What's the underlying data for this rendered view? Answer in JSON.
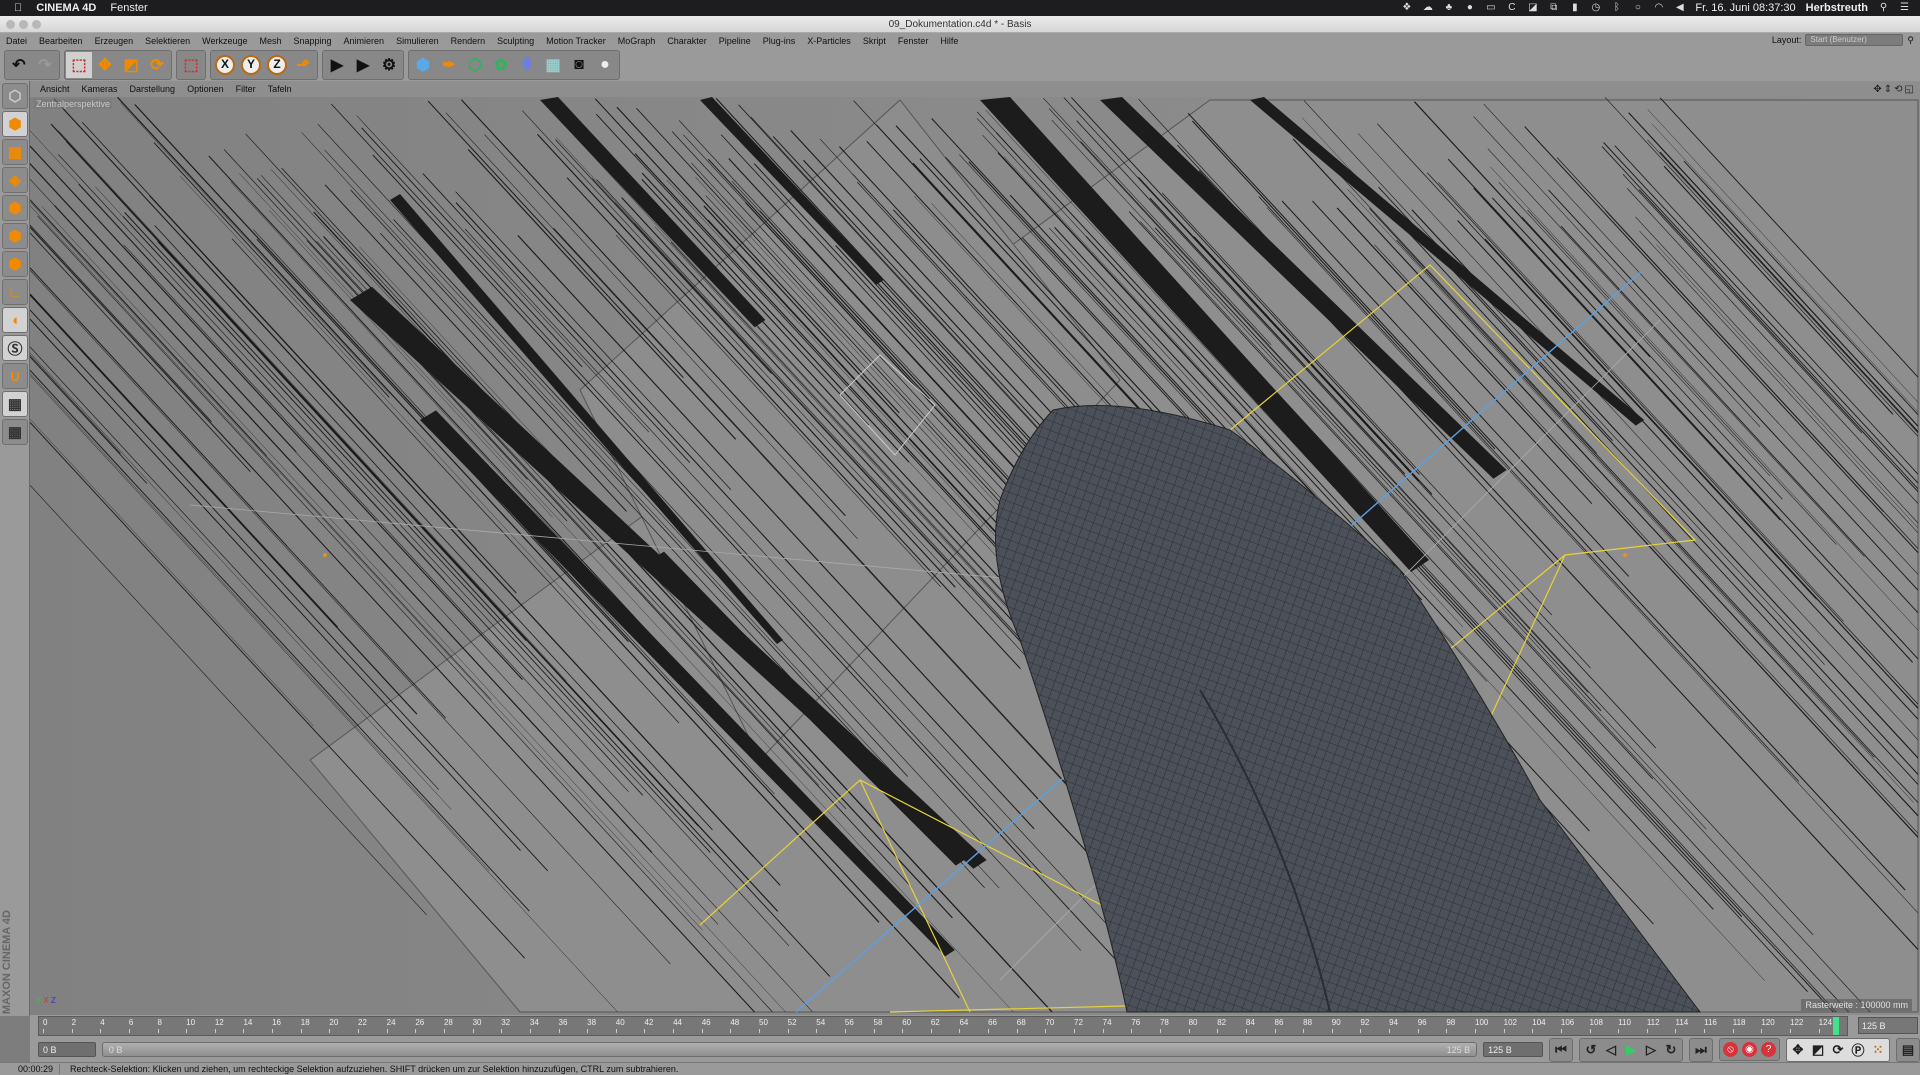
{
  "system_menubar": {
    "app_name": "CINEMA 4D",
    "menu": "Fenster",
    "clock": "Fr. 16. Juni  08:37:30",
    "user": "Herbstreuth",
    "icons": [
      "dropbox-icon",
      "cloud-icon",
      "evernote-icon",
      "location-icon",
      "display-icon",
      "c-icon",
      "note-icon",
      "screenshot-icon",
      "battery-icon",
      "time-machine-icon",
      "bluetooth-icon",
      "siri-icon",
      "wifi-icon",
      "volume-icon",
      "spotlight-icon",
      "notification-center-icon"
    ]
  },
  "window": {
    "title": "09_Dokumentation.c4d * - Basis"
  },
  "menu": [
    "Datei",
    "Bearbeiten",
    "Erzeugen",
    "Selektieren",
    "Werkzeuge",
    "Mesh",
    "Snapping",
    "Animieren",
    "Simulieren",
    "Rendern",
    "Sculpting",
    "Motion Tracker",
    "MoGraph",
    "Charakter",
    "Pipeline",
    "Plug-ins",
    "X-Particles",
    "Skript",
    "Fenster",
    "Hilfe"
  ],
  "layout": {
    "label": "Layout:",
    "value": "Start (Benutzer)"
  },
  "toolbar": {
    "axis_x": "X",
    "axis_y": "Y",
    "axis_z": "Z"
  },
  "view_menu": [
    "Ansicht",
    "Kameras",
    "Darstellung",
    "Optionen",
    "Filter",
    "Tafeln"
  ],
  "viewport": {
    "camera_label": "Zentralperspektive",
    "grid_info": "Rasterweite : 100000 mm",
    "axis_labels": {
      "y": "Y",
      "x": "X",
      "z": "Z"
    },
    "colors": {
      "hair": "#1a1a1a",
      "mesh": "#4a4e56",
      "bbox": "#e6d23a",
      "guide": "#5aa0e6"
    }
  },
  "timeline": {
    "start": 0,
    "end": 124,
    "step": 2,
    "current_frame": 125,
    "end_field": "125 B"
  },
  "controls": {
    "start_field": "0 B",
    "range_start": "0 B",
    "range_end": "125 B",
    "max_field": "125 B"
  },
  "brand": "MAXON CINEMA 4D",
  "status": {
    "time": "00:00:29",
    "message": "Rechteck-Selektion: Klicken und ziehen, um rechteckige Selektion aufzuziehen. SHIFT drücken um zur Selektion hinzuzufügen, CTRL zum subtrahieren."
  }
}
